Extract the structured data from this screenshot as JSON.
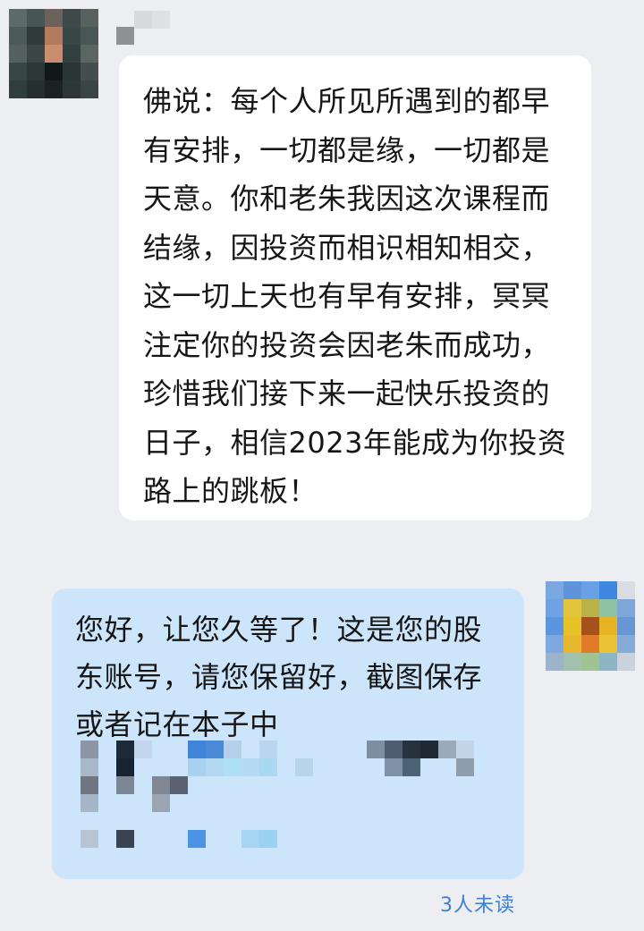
{
  "chat": {
    "messages": [
      {
        "sender": "other",
        "text": "佛说：每个人所见所遇到的都早有安排，一切都是缘，一切都是天意。你和老朱我因这次课程而结缘，因投资而相识相知相交，这一切上天也有早有安排，冥冥注定你的投资会因老朱而成功，珍惜我们接下来一起快乐投资的日子，相信2023年能成为你投资路上的跳板！"
      },
      {
        "sender": "self",
        "text": "您好，让您久等了！这是您的股东账号，请您保留好，截图保存或者记在本子中",
        "read_status": "3人未读"
      }
    ]
  },
  "colors": {
    "background": "#edeef1",
    "incoming_bubble": "#ffffff",
    "outgoing_bubble": "#cde5fb",
    "read_status": "#3f7fd6"
  }
}
